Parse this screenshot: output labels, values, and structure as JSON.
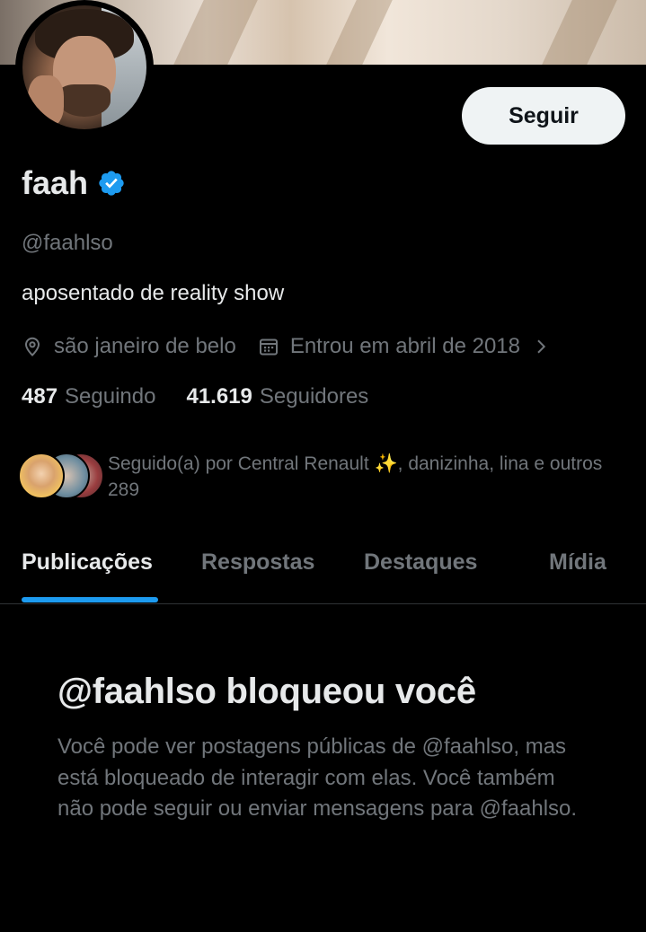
{
  "profile": {
    "follow_button_label": "Seguir",
    "display_name": "faah",
    "handle": "@faahlso",
    "bio": "aposentado de reality show",
    "location": "são janeiro de belo",
    "joined": "Entrou em abril de 2018",
    "following_count": "487",
    "following_label": "Seguindo",
    "followers_count": "41.619",
    "followers_label": "Seguidores",
    "followed_by_text": "Seguido(a) por Central Renault ✨, danizinha, lina e outros 289",
    "verified": true
  },
  "tabs": [
    {
      "label": "Publicações",
      "active": true
    },
    {
      "label": "Respostas",
      "active": false
    },
    {
      "label": "Destaques",
      "active": false
    },
    {
      "label": "Mídia",
      "active": false
    }
  ],
  "blocked": {
    "title": "@faahlso bloqueou você",
    "description": "Você pode ver postagens públicas de @faahlso, mas está bloqueado de interagir com elas. Você também não pode seguir ou enviar mensagens para @faahlso."
  },
  "colors": {
    "background": "#000000",
    "primary_text": "#e7e9ea",
    "secondary_text": "#71767b",
    "accent": "#1d9bf0",
    "button_bg": "#eff3f4",
    "divider": "#2f3336"
  },
  "icons": {
    "verified": "verified-badge-icon",
    "location": "location-pin-icon",
    "calendar": "calendar-icon",
    "chevron": "chevron-right-icon"
  }
}
